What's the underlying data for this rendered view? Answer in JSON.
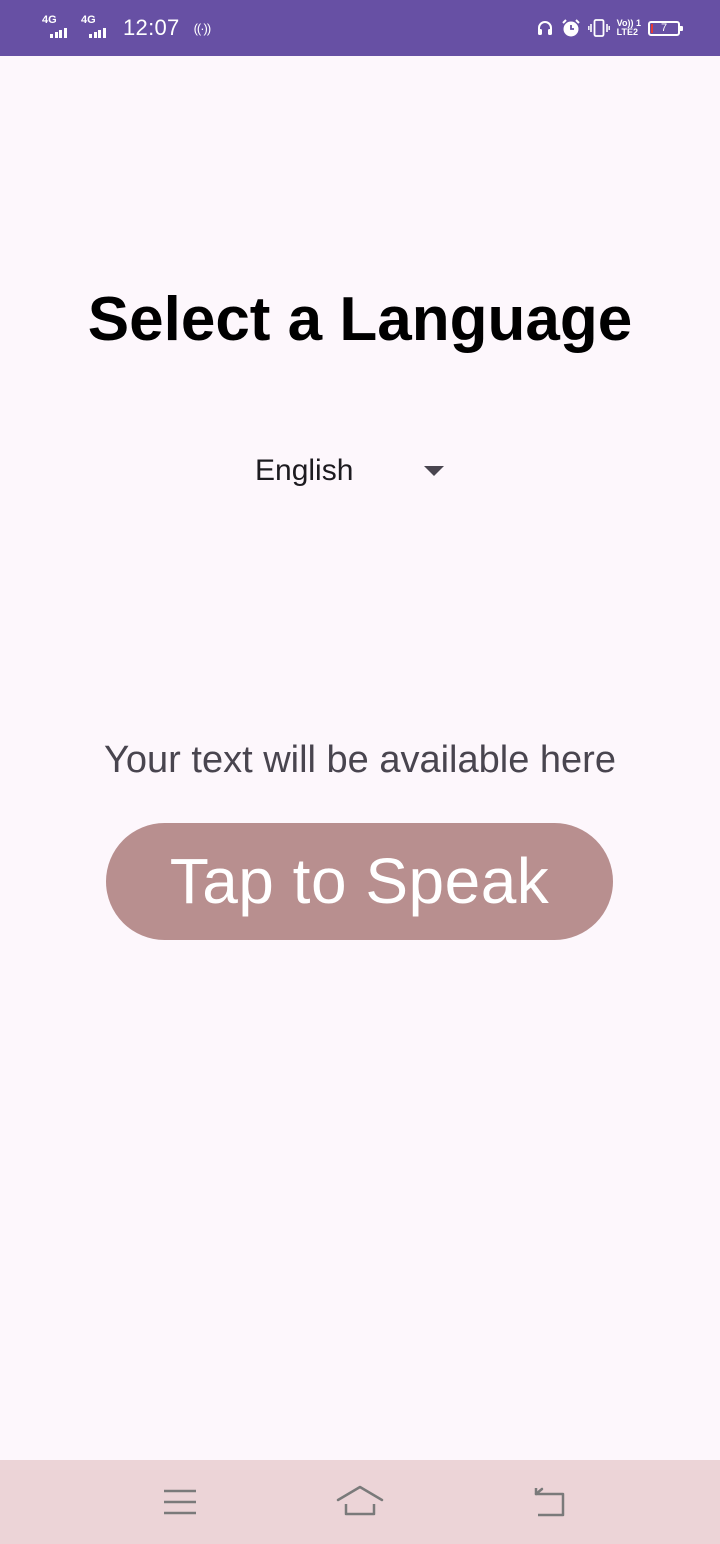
{
  "status_bar": {
    "network1": "4G",
    "network2": "4G",
    "time": "12:07",
    "hotspot_icon": "((·))",
    "volte_line1": "Vo)) 1",
    "volte_line2": "LTE2",
    "battery_level": "7",
    "battery_fraction": 0.07,
    "icons": [
      "headphones-icon",
      "alarm-icon",
      "vibrate-icon",
      "volte-icon",
      "battery-icon"
    ]
  },
  "main": {
    "title": "Select a Language",
    "language_select": {
      "value": "English"
    },
    "result_text": "Your text will be available here",
    "speak_button_label": "Tap to Speak"
  },
  "colors": {
    "status_bar": "#6750a4",
    "background": "#fdf7fc",
    "button": "#b88f8f",
    "nav_bar": "#ecd4d7"
  },
  "nav_bar": {
    "icons": [
      "menu-icon",
      "home-icon",
      "back-icon"
    ]
  }
}
